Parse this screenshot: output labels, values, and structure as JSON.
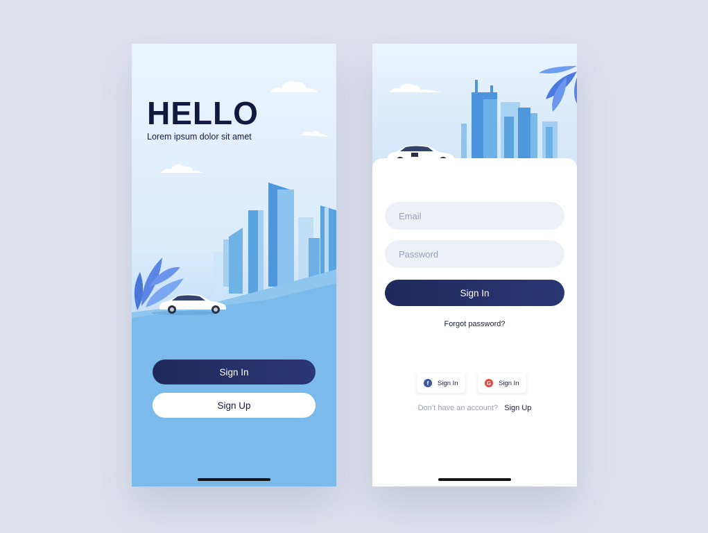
{
  "left_screen": {
    "title": "HELLO",
    "subtitle": "Lorem ipsum dolor sit amet",
    "sign_in_label": "Sign In",
    "sign_up_label": "Sign Up"
  },
  "right_screen": {
    "email_placeholder": "Email",
    "password_placeholder": "Password",
    "sign_in_label": "Sign In",
    "forgot_password": "Forgot password?",
    "facebook_sign_in": "Sign In",
    "google_sign_in": "Sign In",
    "no_account_text": "Don’t have an account?",
    "sign_up_link": "Sign Up"
  },
  "icons": {
    "facebook": "facebook-icon",
    "google": "google-plus-icon"
  },
  "colors": {
    "background": "#dfe1ec",
    "primary_button": "#1f2a5c",
    "sky_light": "#eaf4fe",
    "ground_blue": "#7bbaeb",
    "field_bg": "#eef0f8",
    "facebook": "#3b5998",
    "google": "#e8453c"
  }
}
